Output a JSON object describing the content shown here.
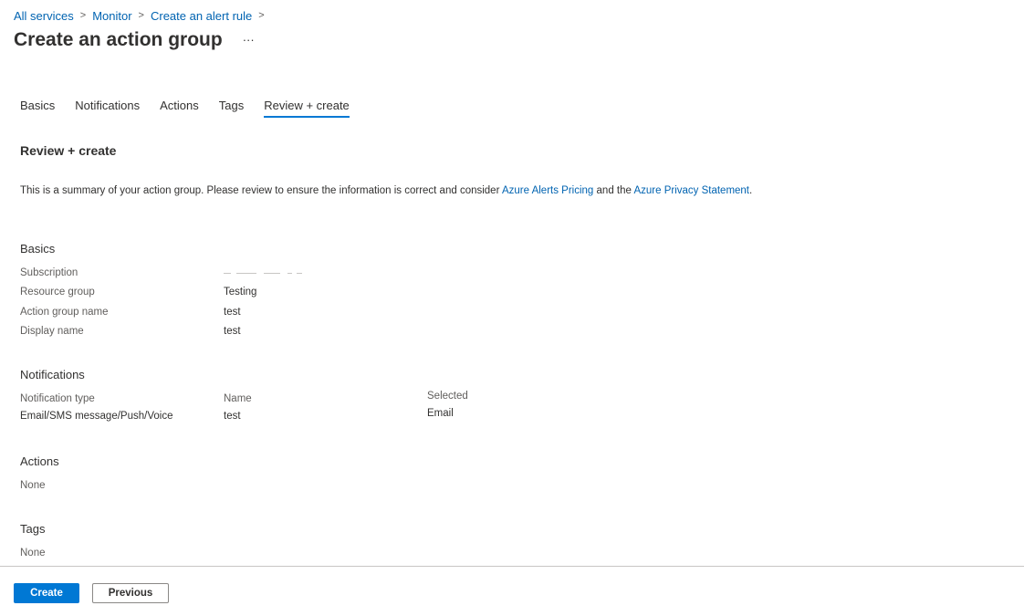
{
  "breadcrumb": {
    "items": [
      "All services",
      "Monitor",
      "Create an alert rule"
    ],
    "separator": ">"
  },
  "header": {
    "title": "Create an action group",
    "more_label": "···"
  },
  "tabs": [
    "Basics",
    "Notifications",
    "Actions",
    "Tags",
    "Review + create"
  ],
  "active_tab": "Review + create",
  "review": {
    "heading": "Review + create",
    "summary_prefix": "This is a summary of your action group. Please review to ensure the information is correct and consider ",
    "link_pricing": "Azure Alerts Pricing",
    "summary_middle": " and the ",
    "link_privacy": "Azure Privacy Statement",
    "summary_suffix": "."
  },
  "basics": {
    "title": "Basics",
    "subscription_label": "Subscription",
    "resource_group_label": "Resource group",
    "resource_group_value": "Testing",
    "action_group_name_label": "Action group name",
    "action_group_name_value": "test",
    "display_name_label": "Display name",
    "display_name_value": "test"
  },
  "notifications": {
    "title": "Notifications",
    "headers": [
      "Notification type",
      "Name",
      "Selected"
    ],
    "rows": [
      [
        "Email/SMS message/Push/Voice",
        "test",
        "Email"
      ]
    ]
  },
  "actions": {
    "title": "Actions",
    "value": "None"
  },
  "tags": {
    "title": "Tags",
    "value": "None"
  },
  "footer": {
    "create_label": "Create",
    "previous_label": "Previous"
  },
  "colors": {
    "accent": "#0078d4",
    "link": "#0063b1",
    "text": "#323130"
  },
  "icons": {
    "more": "ellipsis-icon",
    "separator": "chevron-right-icon"
  }
}
